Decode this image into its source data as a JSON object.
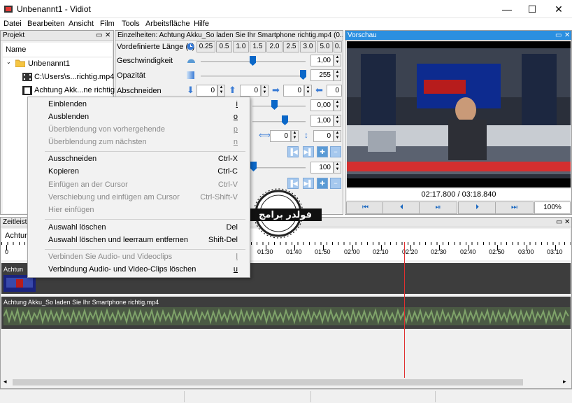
{
  "window": {
    "title": "Unbenannt1 - Vidiot",
    "minimize": "—",
    "maximize": "☐",
    "close": "✕"
  },
  "menubar": [
    "Datei",
    "Bearbeiten",
    "Ansicht",
    "Film",
    "Tools",
    "Arbeitsfläche",
    "Hilfe"
  ],
  "project": {
    "title": "Projekt",
    "column": "Name",
    "root": "Unbenannt1",
    "items": [
      "C:\\Users\\s...richtig.mp4",
      "Achtung Akk...ne richtig"
    ]
  },
  "details": {
    "title": "Einzelheiten: Achtung Akku_So laden Sie Ihr Smartphone richtig.mp4 (0...",
    "presets_label": "Vordefinierte Länge (s)",
    "presets": [
      "0.25",
      "0.5",
      "1.0",
      "1.5",
      "2.0",
      "2.5",
      "3.0",
      "5.0",
      "0."
    ],
    "speed_label": "Geschwindigkeit",
    "speed_value": "1,00",
    "opacity_label": "Opazität",
    "opacity_value": "255",
    "crop_label": "Abschneiden",
    "crop_values": [
      "0",
      "0",
      "0",
      "0"
    ],
    "row4_value": "0,00",
    "row5_value": "1,00",
    "offset_values": [
      "0",
      "0"
    ],
    "volume_value": "100"
  },
  "preview": {
    "title": "Vorschau",
    "time": "02:17.800 / 03:18.840",
    "zoom": "100%"
  },
  "context_menu": {
    "items": [
      {
        "label": "Einblenden",
        "shortcut": "i",
        "disabled": false
      },
      {
        "label": "Ausblenden",
        "shortcut": "o",
        "disabled": false
      },
      {
        "label": "Überblendung von vorhergehende",
        "shortcut": "p",
        "disabled": true
      },
      {
        "label": "Überblendung zum nächsten",
        "shortcut": "n",
        "disabled": true
      },
      {
        "label": "Ausschneiden",
        "shortcut": "Ctrl-X",
        "disabled": false
      },
      {
        "label": "Kopieren",
        "shortcut": "Ctrl-C",
        "disabled": false
      },
      {
        "label": "Einfügen an der Cursor",
        "shortcut": "Ctrl-V",
        "disabled": true
      },
      {
        "label": "Verschiebung und einfügen am Cursor",
        "shortcut": "Ctrl-Shift-V",
        "disabled": true
      },
      {
        "label": "Hier einfügen",
        "shortcut": "",
        "disabled": true
      },
      {
        "label": "Auswahl löschen",
        "shortcut": "Del",
        "disabled": false
      },
      {
        "label": "Auswahl löschen und leerraum entfernen",
        "shortcut": "Shift-Del",
        "disabled": false
      },
      {
        "label": "Verbinden Sie Audio- und Videoclips",
        "shortcut": "l",
        "disabled": true
      },
      {
        "label": "Verbindung Audio- und Video-Clips löschen",
        "shortcut": "u",
        "disabled": false
      }
    ]
  },
  "timeline": {
    "title": "Zeitleiste",
    "tab": "Achtun",
    "ticks": [
      "0",
      "01:30",
      "01:40",
      "01:50",
      "02:00",
      "02:10",
      "02:20",
      "02:30",
      "02:40",
      "02:50",
      "03:00",
      "03:10"
    ],
    "video_label": "Achtun",
    "audio_label": "Achtung Akku_So laden Sie Ihr Smartphone richtig.mp4"
  },
  "watermark": {
    "text": "فولدر برامج"
  },
  "colors": {
    "accent": "#2b8fe0",
    "playhead": "#e03030",
    "waveform": "#7fa36a",
    "track": "#3d3d3d"
  }
}
